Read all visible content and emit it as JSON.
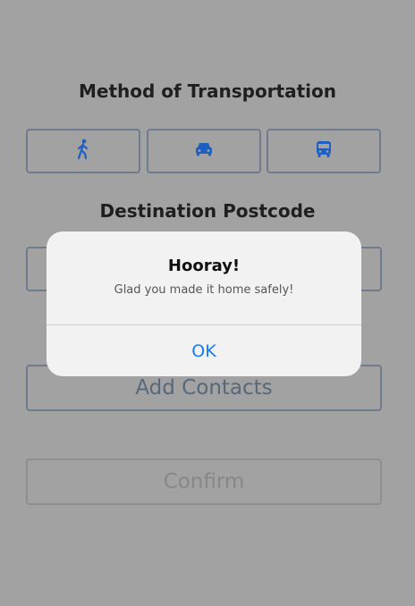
{
  "screen": {
    "method_heading": "Method of Transportation",
    "destination_heading": "Destination Postcode",
    "transport_modes": [
      {
        "icon": "walking-person-icon"
      },
      {
        "icon": "car-icon"
      },
      {
        "icon": "bus-icon"
      }
    ],
    "postcode_value": "",
    "add_contacts_label": "Add Contacts",
    "confirm_label": "Confirm"
  },
  "alert": {
    "title": "Hooray!",
    "message": "Glad you made it home safely!",
    "ok_label": "OK"
  },
  "colors": {
    "accent": "#1a7cf0",
    "icon": "#1f5fbf",
    "dimmed_background": "#a2a2a2",
    "alert_background": "#f2f2f2"
  }
}
